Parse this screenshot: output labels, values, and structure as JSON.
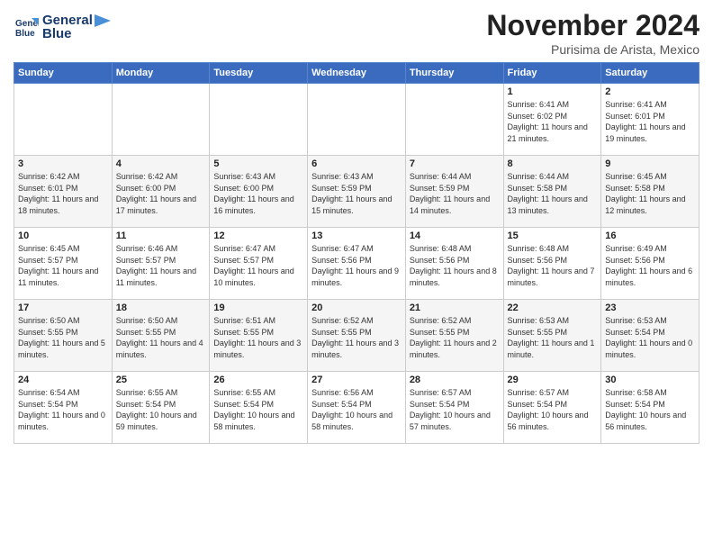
{
  "logo": {
    "line1": "General",
    "line2": "Blue"
  },
  "title": "November 2024",
  "location": "Purisima de Arista, Mexico",
  "days_of_week": [
    "Sunday",
    "Monday",
    "Tuesday",
    "Wednesday",
    "Thursday",
    "Friday",
    "Saturday"
  ],
  "weeks": [
    [
      {
        "day": "",
        "info": ""
      },
      {
        "day": "",
        "info": ""
      },
      {
        "day": "",
        "info": ""
      },
      {
        "day": "",
        "info": ""
      },
      {
        "day": "",
        "info": ""
      },
      {
        "day": "1",
        "info": "Sunrise: 6:41 AM\nSunset: 6:02 PM\nDaylight: 11 hours and 21 minutes."
      },
      {
        "day": "2",
        "info": "Sunrise: 6:41 AM\nSunset: 6:01 PM\nDaylight: 11 hours and 19 minutes."
      }
    ],
    [
      {
        "day": "3",
        "info": "Sunrise: 6:42 AM\nSunset: 6:01 PM\nDaylight: 11 hours and 18 minutes."
      },
      {
        "day": "4",
        "info": "Sunrise: 6:42 AM\nSunset: 6:00 PM\nDaylight: 11 hours and 17 minutes."
      },
      {
        "day": "5",
        "info": "Sunrise: 6:43 AM\nSunset: 6:00 PM\nDaylight: 11 hours and 16 minutes."
      },
      {
        "day": "6",
        "info": "Sunrise: 6:43 AM\nSunset: 5:59 PM\nDaylight: 11 hours and 15 minutes."
      },
      {
        "day": "7",
        "info": "Sunrise: 6:44 AM\nSunset: 5:59 PM\nDaylight: 11 hours and 14 minutes."
      },
      {
        "day": "8",
        "info": "Sunrise: 6:44 AM\nSunset: 5:58 PM\nDaylight: 11 hours and 13 minutes."
      },
      {
        "day": "9",
        "info": "Sunrise: 6:45 AM\nSunset: 5:58 PM\nDaylight: 11 hours and 12 minutes."
      }
    ],
    [
      {
        "day": "10",
        "info": "Sunrise: 6:45 AM\nSunset: 5:57 PM\nDaylight: 11 hours and 11 minutes."
      },
      {
        "day": "11",
        "info": "Sunrise: 6:46 AM\nSunset: 5:57 PM\nDaylight: 11 hours and 11 minutes."
      },
      {
        "day": "12",
        "info": "Sunrise: 6:47 AM\nSunset: 5:57 PM\nDaylight: 11 hours and 10 minutes."
      },
      {
        "day": "13",
        "info": "Sunrise: 6:47 AM\nSunset: 5:56 PM\nDaylight: 11 hours and 9 minutes."
      },
      {
        "day": "14",
        "info": "Sunrise: 6:48 AM\nSunset: 5:56 PM\nDaylight: 11 hours and 8 minutes."
      },
      {
        "day": "15",
        "info": "Sunrise: 6:48 AM\nSunset: 5:56 PM\nDaylight: 11 hours and 7 minutes."
      },
      {
        "day": "16",
        "info": "Sunrise: 6:49 AM\nSunset: 5:56 PM\nDaylight: 11 hours and 6 minutes."
      }
    ],
    [
      {
        "day": "17",
        "info": "Sunrise: 6:50 AM\nSunset: 5:55 PM\nDaylight: 11 hours and 5 minutes."
      },
      {
        "day": "18",
        "info": "Sunrise: 6:50 AM\nSunset: 5:55 PM\nDaylight: 11 hours and 4 minutes."
      },
      {
        "day": "19",
        "info": "Sunrise: 6:51 AM\nSunset: 5:55 PM\nDaylight: 11 hours and 3 minutes."
      },
      {
        "day": "20",
        "info": "Sunrise: 6:52 AM\nSunset: 5:55 PM\nDaylight: 11 hours and 3 minutes."
      },
      {
        "day": "21",
        "info": "Sunrise: 6:52 AM\nSunset: 5:55 PM\nDaylight: 11 hours and 2 minutes."
      },
      {
        "day": "22",
        "info": "Sunrise: 6:53 AM\nSunset: 5:55 PM\nDaylight: 11 hours and 1 minute."
      },
      {
        "day": "23",
        "info": "Sunrise: 6:53 AM\nSunset: 5:54 PM\nDaylight: 11 hours and 0 minutes."
      }
    ],
    [
      {
        "day": "24",
        "info": "Sunrise: 6:54 AM\nSunset: 5:54 PM\nDaylight: 11 hours and 0 minutes."
      },
      {
        "day": "25",
        "info": "Sunrise: 6:55 AM\nSunset: 5:54 PM\nDaylight: 10 hours and 59 minutes."
      },
      {
        "day": "26",
        "info": "Sunrise: 6:55 AM\nSunset: 5:54 PM\nDaylight: 10 hours and 58 minutes."
      },
      {
        "day": "27",
        "info": "Sunrise: 6:56 AM\nSunset: 5:54 PM\nDaylight: 10 hours and 58 minutes."
      },
      {
        "day": "28",
        "info": "Sunrise: 6:57 AM\nSunset: 5:54 PM\nDaylight: 10 hours and 57 minutes."
      },
      {
        "day": "29",
        "info": "Sunrise: 6:57 AM\nSunset: 5:54 PM\nDaylight: 10 hours and 56 minutes."
      },
      {
        "day": "30",
        "info": "Sunrise: 6:58 AM\nSunset: 5:54 PM\nDaylight: 10 hours and 56 minutes."
      }
    ]
  ]
}
